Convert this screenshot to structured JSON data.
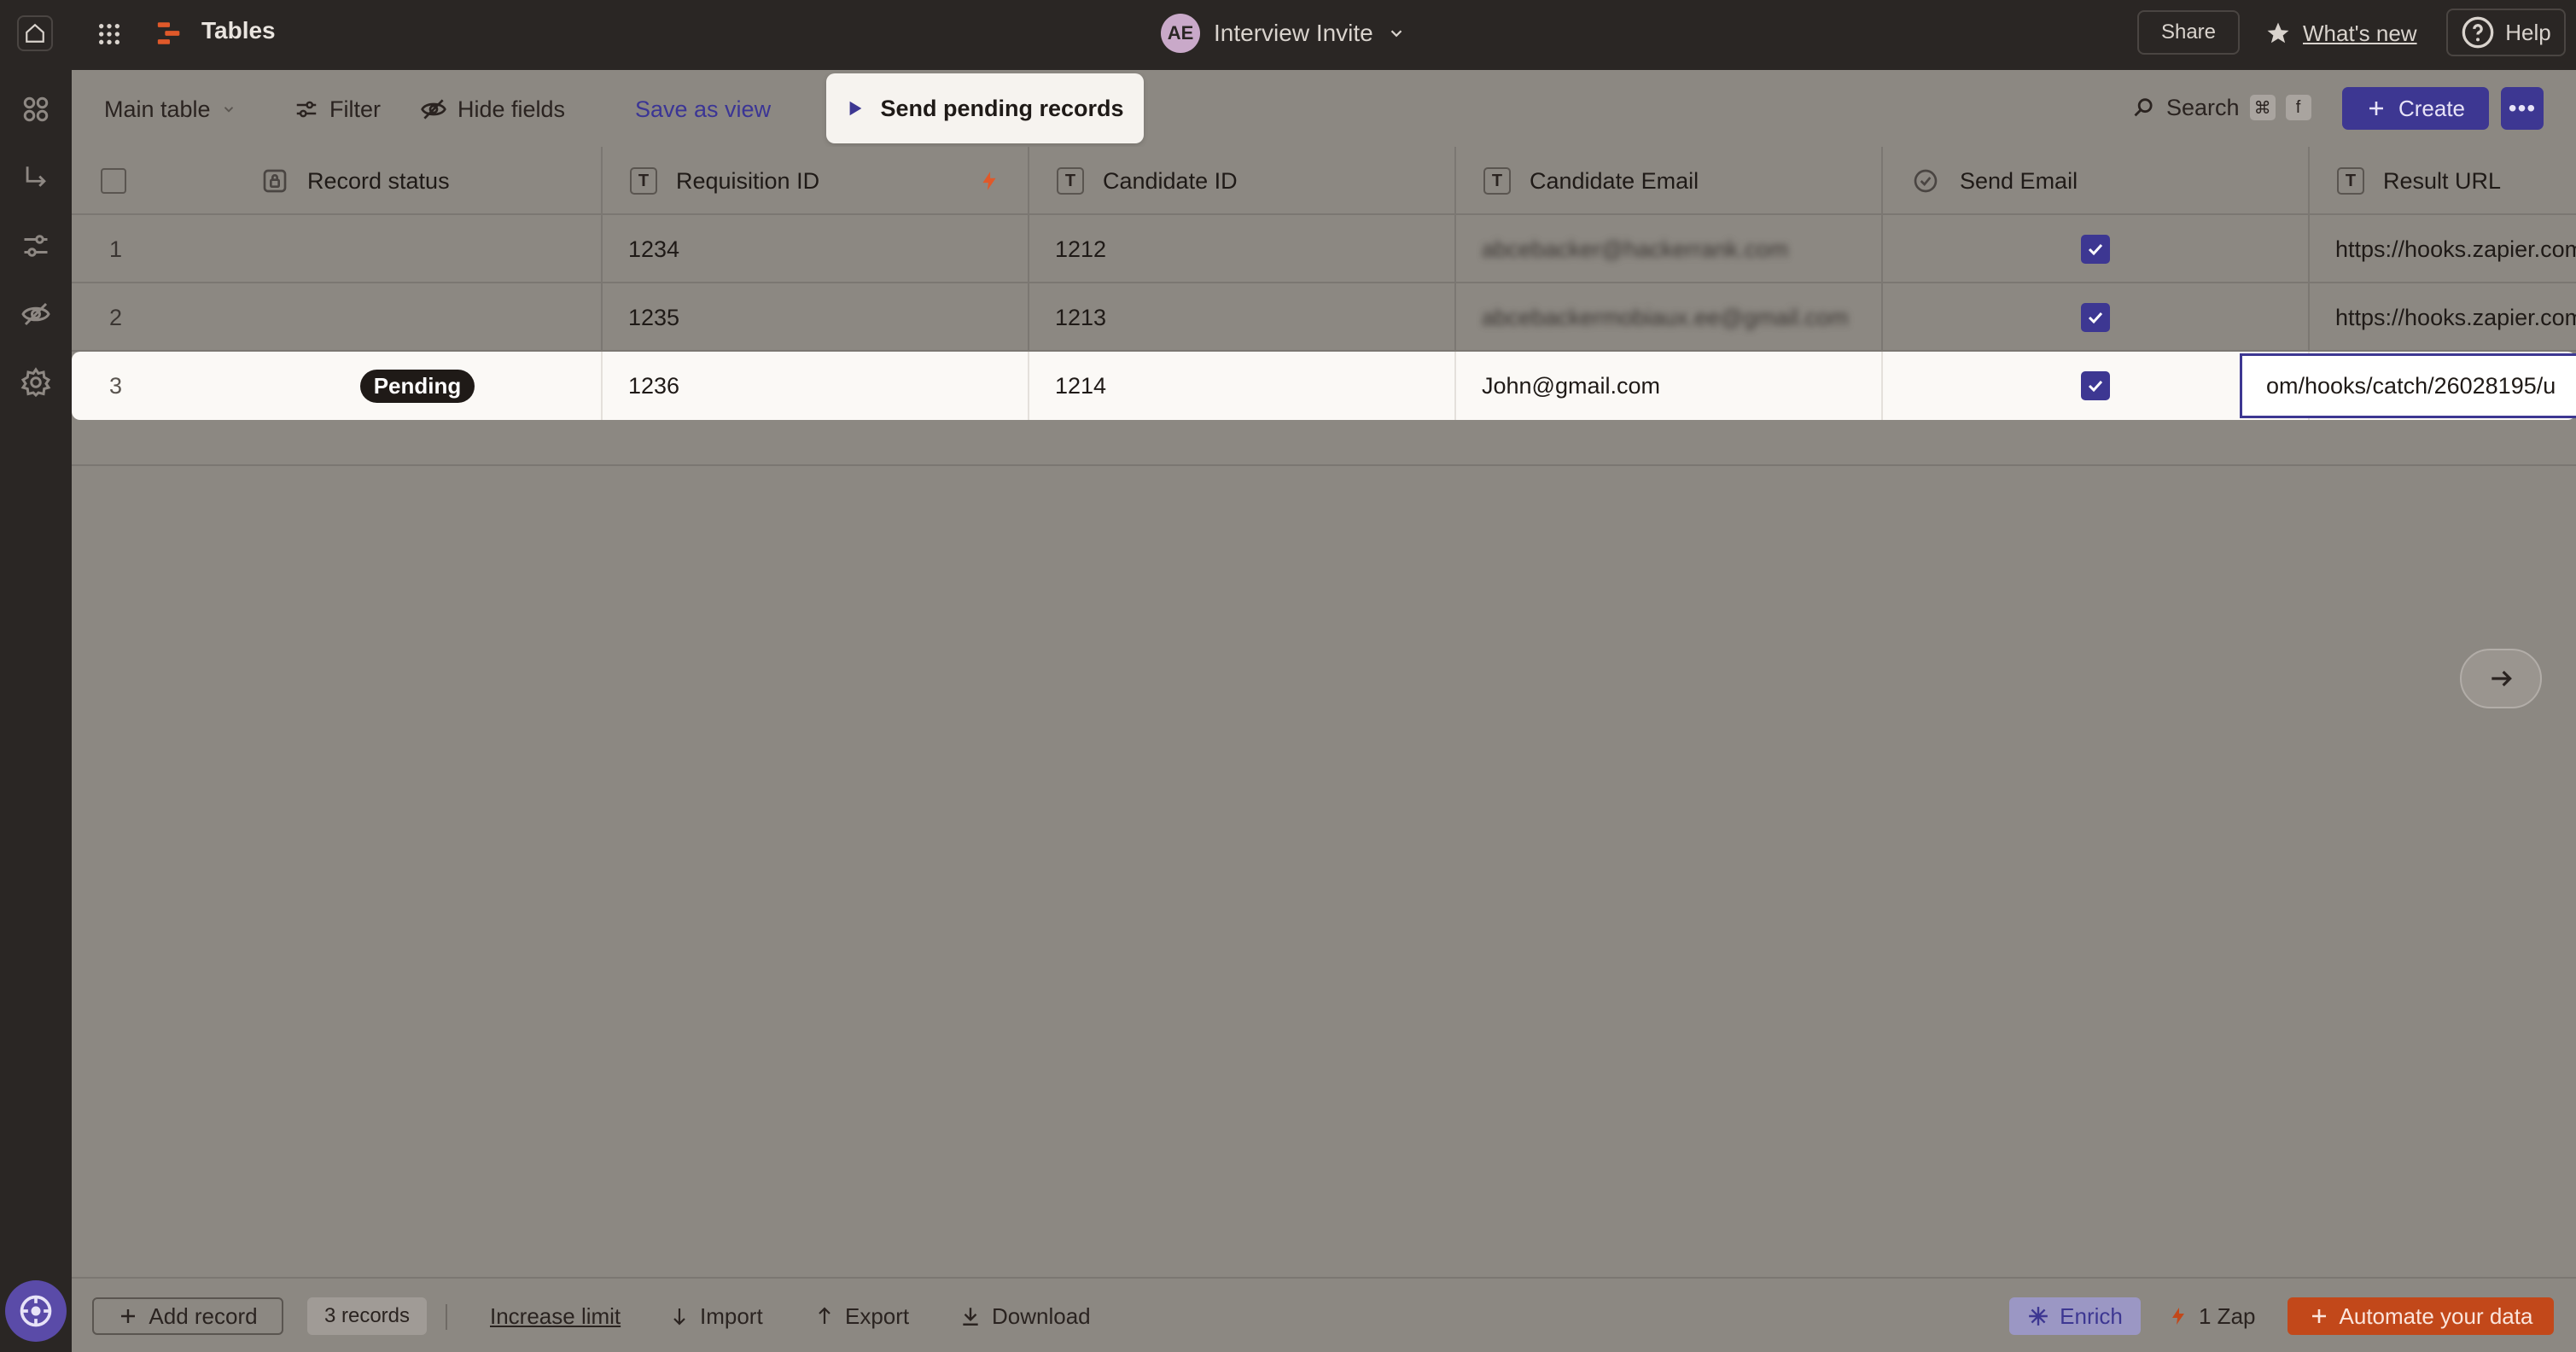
{
  "topbar": {
    "app_title": "Tables",
    "avatar_initials": "AE",
    "doc_title": "Interview Invite",
    "share_label": "Share",
    "whats_new_label": "What's new",
    "help_label": "Help"
  },
  "toolbar": {
    "view_label": "Main table",
    "filter_label": "Filter",
    "hide_fields_label": "Hide fields",
    "save_view_label": "Save as view",
    "send_pending_label": "Send pending records",
    "search_label": "Search",
    "search_kbd": [
      "⌘",
      "f"
    ],
    "create_label": "Create",
    "more_label": "•••"
  },
  "columns": [
    {
      "label": "Record status"
    },
    {
      "label": "Requisition ID"
    },
    {
      "label": "Candidate ID"
    },
    {
      "label": "Candidate Email"
    },
    {
      "label": "Send Email"
    },
    {
      "label": "Result URL"
    }
  ],
  "rows": [
    {
      "num": "1",
      "status": "",
      "requisition_id": "1234",
      "candidate_id": "1212",
      "email": "abcebacker@hackerrank.com",
      "send_email": true,
      "result_url": "https://hooks.zapier.com/hoo"
    },
    {
      "num": "2",
      "status": "",
      "requisition_id": "1235",
      "candidate_id": "1213",
      "email": "abcebackermobiaux.ee@gmail.com",
      "send_email": true,
      "result_url": "https://hooks.zapier.com/hoo"
    },
    {
      "num": "3",
      "status": "Pending",
      "requisition_id": "1236",
      "candidate_id": "1214",
      "email": "John@gmail.com",
      "send_email": true,
      "result_url": "om/hooks/catch/26028195/u"
    }
  ],
  "footer": {
    "add_record_label": "Add record",
    "records_count": "3 records",
    "increase_limit_label": "Increase limit",
    "import_label": "Import",
    "export_label": "Export",
    "download_label": "Download",
    "enrich_label": "Enrich",
    "zap_label": "1 Zap",
    "automate_label": "Automate your data"
  },
  "colors": {
    "accent": "#3d3792",
    "brand_orange": "#c2481a"
  }
}
